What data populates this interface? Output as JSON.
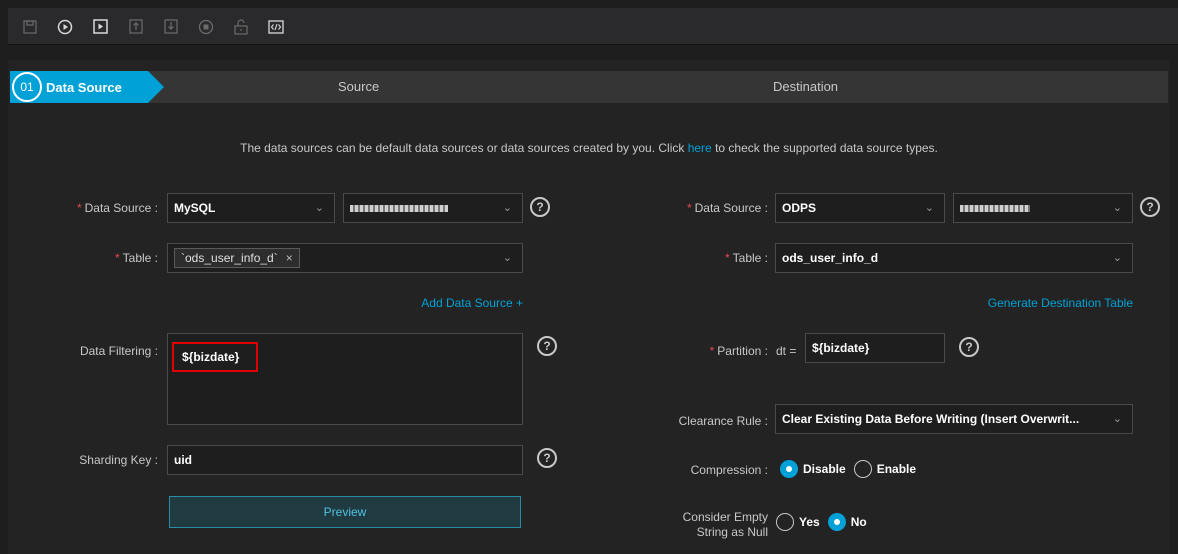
{
  "toolbar": {
    "icons": [
      "save-icon",
      "run-icon",
      "run-with-params-icon",
      "submit-icon",
      "publish-icon",
      "stop-icon",
      "unlock-icon",
      "script-mode-icon"
    ]
  },
  "steps": {
    "active_number": "01",
    "active_label": "Data Source",
    "source_label": "Source",
    "destination_label": "Destination"
  },
  "info": {
    "before_link": "The data sources can be default data sources or data sources created by you. Click ",
    "link": "here",
    "after_link": " to check the supported data source types."
  },
  "source": {
    "data_source_label": "Data Source",
    "data_source_type": "MySQL",
    "data_source_name": "",
    "table_label": "Table",
    "table_tag": "`ods_user_info_d`",
    "add_data_source": "Add Data Source +",
    "data_filtering_label": "Data Filtering",
    "data_filtering_value": "${bizdate}",
    "sharding_key_label": "Sharding Key",
    "sharding_key_value": "uid",
    "preview_button": "Preview"
  },
  "destination": {
    "data_source_label": "Data Source",
    "data_source_type": "ODPS",
    "data_source_name": "",
    "table_label": "Table",
    "table_value": "ods_user_info_d",
    "generate_table": "Generate Destination Table",
    "partition_label": "Partition",
    "partition_prefix": "dt =",
    "partition_value": "${bizdate}",
    "clearance_rule_label": "Clearance Rule",
    "clearance_rule_value": "Clear Existing Data Before Writing (Insert Overwrit...",
    "compression_label": "Compression",
    "compression_options": [
      "Disable",
      "Enable"
    ],
    "compression_selected": "Disable",
    "empty_null_label_1": "Consider Empty",
    "empty_null_label_2": "String as Null",
    "empty_null_options": [
      "Yes",
      "No"
    ],
    "empty_null_selected": "No"
  },
  "colors": {
    "accent": "#00a1d6",
    "required": "#e5484d",
    "highlight": "#e00000"
  }
}
